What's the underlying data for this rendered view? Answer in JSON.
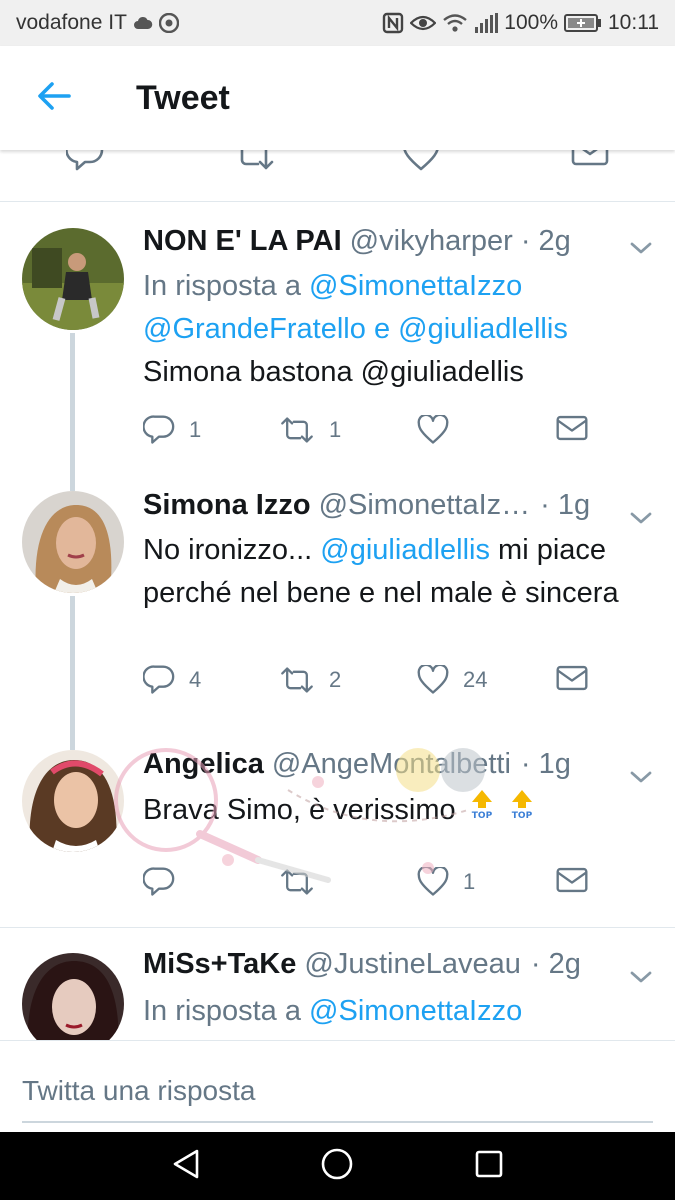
{
  "status_bar": {
    "carrier": "vodafone IT",
    "battery": "100%",
    "time": "10:11"
  },
  "header": {
    "title": "Tweet"
  },
  "tweets": [
    {
      "name": "NON E' LA PAI",
      "handle": "@vikyharper",
      "time": "· 2g",
      "reply_prefix": "In risposta a",
      "reply_to_1": "@SimonettaIzzo",
      "reply_to_2": "@GrandeFratello",
      "reply_and": "e",
      "reply_to_3": "@giuliadlellis",
      "text": "Simona bastona @giuliadellis",
      "replies": "1",
      "retweets": "1",
      "likes": ""
    },
    {
      "name": "Simona Izzo",
      "handle": "@SimonettaIz…",
      "time": "· 1g",
      "text_1": "No ironizzo...",
      "mention": "@giuliadlellis",
      "text_2": "mi piace perché nel bene e nel male è sincera",
      "replies": "4",
      "retweets": "2",
      "likes": "24"
    },
    {
      "name": "Angelica",
      "handle": "@AngeMontalbetti",
      "time": "· 1g",
      "text": "Brava Simo, è verissimo",
      "replies": "",
      "retweets": "",
      "likes": "1"
    },
    {
      "name": "MiSs+TaKe",
      "handle": "@JustineLaveau",
      "time": "· 2g",
      "reply_prefix": "In risposta a",
      "reply_to_1": "@SimonettaIzzo"
    }
  ],
  "reply_bar": {
    "placeholder": "Twitta una risposta"
  },
  "colors": {
    "accent": "#1da1f2",
    "muted": "#657786",
    "text": "#14171a",
    "divider": "#e1e8ed",
    "thread": "#ccd6dd"
  }
}
